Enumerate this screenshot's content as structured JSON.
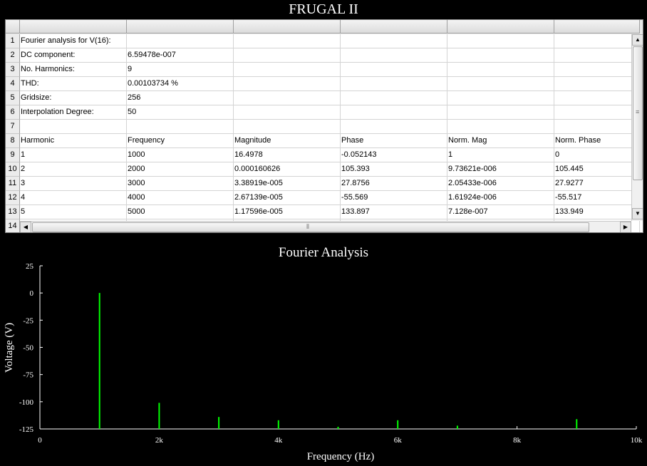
{
  "window": {
    "title": "FRUGAL II"
  },
  "grid": {
    "row_numbers": [
      "1",
      "2",
      "3",
      "4",
      "5",
      "6",
      "7",
      "8",
      "9",
      "10",
      "11",
      "12",
      "13",
      "14"
    ],
    "rows": [
      [
        "Fourier analysis for V(16):",
        "",
        "",
        "",
        "",
        ""
      ],
      [
        "DC component:",
        "6.59478e-007",
        "",
        "",
        "",
        ""
      ],
      [
        "No. Harmonics:",
        "9",
        "",
        "",
        "",
        ""
      ],
      [
        "THD:",
        "0.00103734 %",
        "",
        "",
        "",
        ""
      ],
      [
        "Gridsize:",
        "256",
        "",
        "",
        "",
        ""
      ],
      [
        "Interpolation Degree:",
        "50",
        "",
        "",
        "",
        ""
      ],
      [
        "",
        "",
        "",
        "",
        "",
        ""
      ],
      [
        "Harmonic",
        "Frequency",
        "Magnitude",
        "Phase",
        "Norm. Mag",
        "Norm. Phase"
      ],
      [
        "1",
        "1000",
        "16.4978",
        "-0.052143",
        "1",
        "0"
      ],
      [
        "2",
        "2000",
        "0.000160626",
        "105.393",
        "9.73621e-006",
        "105.445"
      ],
      [
        "3",
        "3000",
        "3.38919e-005",
        "27.8756",
        "2.05433e-006",
        "27.9277"
      ],
      [
        "4",
        "4000",
        "2.67139e-005",
        "-55.569",
        "1.61924e-006",
        "-55.517"
      ],
      [
        "5",
        "5000",
        "1.17596e-005",
        "133.897",
        "7.128e-007",
        "133.949"
      ]
    ]
  },
  "chart_data": {
    "type": "bar",
    "title": "Fourier Analysis",
    "xlabel": "Frequency (Hz)",
    "ylabel": "Voltage (V)",
    "xlim": [
      0,
      10000
    ],
    "ylim": [
      -125,
      25
    ],
    "x_ticks": [
      0,
      2000,
      4000,
      6000,
      8000,
      10000
    ],
    "x_tick_labels": [
      "0",
      "2k",
      "4k",
      "6k",
      "8k",
      "10k"
    ],
    "y_ticks": [
      25,
      0,
      -25,
      -50,
      -75,
      -100,
      -125
    ],
    "y_tick_labels": [
      "25",
      "0",
      "-25",
      "-50",
      "-75",
      "-100",
      "-125"
    ],
    "series": [
      {
        "x": [
          1000,
          2000,
          3000,
          4000,
          5000,
          6000,
          7000,
          8000,
          9000
        ],
        "values": [
          0,
          -101,
          -114,
          -117,
          -123,
          -117,
          -122,
          -125,
          -116
        ]
      }
    ],
    "bar_color": "#00ff00",
    "axis_color": "#ffffff",
    "background": "#000000",
    "grid": false
  }
}
